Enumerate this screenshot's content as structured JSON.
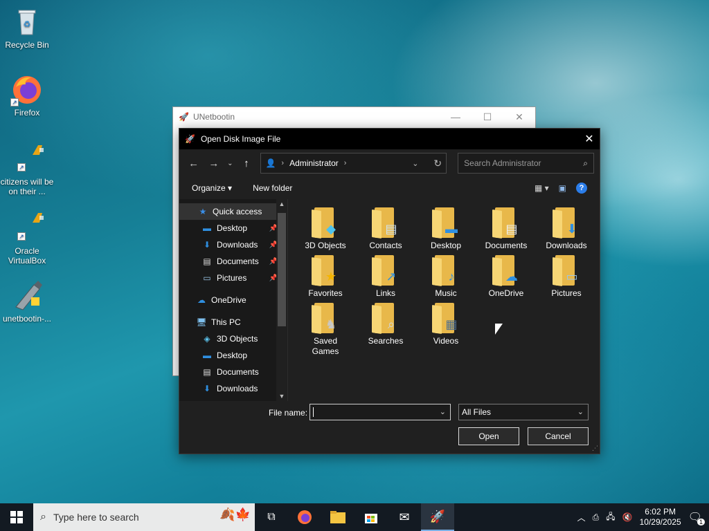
{
  "desktop": {
    "icons": [
      {
        "label": "Recycle Bin"
      },
      {
        "label": "Firefox"
      },
      {
        "label": "citizens will be on their ..."
      },
      {
        "label": "Oracle VirtualBox"
      },
      {
        "label": "unetbootin-..."
      }
    ]
  },
  "bg_window": {
    "title": "UNetbootin",
    "controls": {
      "minimize": "—",
      "maximize": "☐",
      "close": "✕"
    }
  },
  "dialog": {
    "title": "Open Disk Image File",
    "close_glyph": "✕",
    "address": {
      "segment": "Administrator",
      "separator": "›"
    },
    "search": {
      "placeholder": "Search Administrator"
    },
    "toolbar": {
      "organize": "Organize ▾",
      "new_folder": "New folder",
      "help": "?"
    },
    "nav": [
      {
        "label": "Quick access",
        "icon": "star-icon",
        "selected": true
      },
      {
        "label": "Desktop",
        "icon": "desktop-icon",
        "pinned": true
      },
      {
        "label": "Downloads",
        "icon": "download-icon",
        "pinned": true
      },
      {
        "label": "Documents",
        "icon": "document-icon",
        "pinned": true
      },
      {
        "label": "Pictures",
        "icon": "pictures-icon",
        "pinned": true
      },
      {
        "label": "OneDrive",
        "icon": "cloud-icon"
      },
      {
        "label": "This PC",
        "icon": "computer-icon"
      },
      {
        "label": "3D Objects",
        "icon": "cube-icon"
      },
      {
        "label": "Desktop",
        "icon": "desktop-icon"
      },
      {
        "label": "Documents",
        "icon": "document-icon"
      },
      {
        "label": "Downloads",
        "icon": "download-icon"
      }
    ],
    "folders": [
      {
        "label": "3D Objects",
        "icon": "cube-icon"
      },
      {
        "label": "Contacts",
        "icon": "contact-card-icon"
      },
      {
        "label": "Desktop",
        "icon": "desktop-icon"
      },
      {
        "label": "Documents",
        "icon": "document-icon"
      },
      {
        "label": "Downloads",
        "icon": "download-icon"
      },
      {
        "label": "Favorites",
        "icon": "star-icon"
      },
      {
        "label": "Links",
        "icon": "link-arrow-icon"
      },
      {
        "label": "Music",
        "icon": "music-note-icon"
      },
      {
        "label": "OneDrive",
        "icon": "cloud-icon"
      },
      {
        "label": "Pictures",
        "icon": "landscape-icon"
      },
      {
        "label": "Saved Games",
        "icon": "chess-piece-icon"
      },
      {
        "label": "Searches",
        "icon": "magnifier-icon"
      },
      {
        "label": "Videos",
        "icon": "film-icon"
      }
    ],
    "file_name_label": "File name:",
    "file_name_value": "",
    "file_type": "All Files",
    "open_button": "Open",
    "cancel_button": "Cancel"
  },
  "taskbar": {
    "search_placeholder": "Type here to search",
    "clock_time": "6:02 PM",
    "clock_date": "10/29/2025",
    "notification_count": "1"
  },
  "colors": {
    "accent": "#2b7de9",
    "dialog_bg": "#202020",
    "folder": "#e8b84a"
  }
}
